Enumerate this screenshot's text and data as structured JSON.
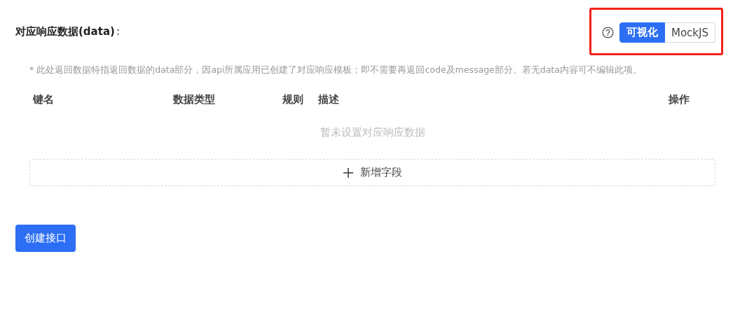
{
  "section": {
    "title": "对应响应数据(data)",
    "colon": ":"
  },
  "mode_switch": [
    {
      "label": "可视化",
      "selected": true
    },
    {
      "label": "MockJS",
      "selected": false
    }
  ],
  "note": "* 此处返回数据特指返回数据的data部分，因api所属应用已创建了对应响应模板；即不需要再返回code及message部分。若无data内容可不编辑此项。",
  "table": {
    "columns": [
      "键名",
      "数据类型",
      "规则",
      "描述",
      "操作"
    ],
    "empty_text": "暂未设置对应响应数据"
  },
  "add_button": "新增字段",
  "submit_button": "创建接口"
}
